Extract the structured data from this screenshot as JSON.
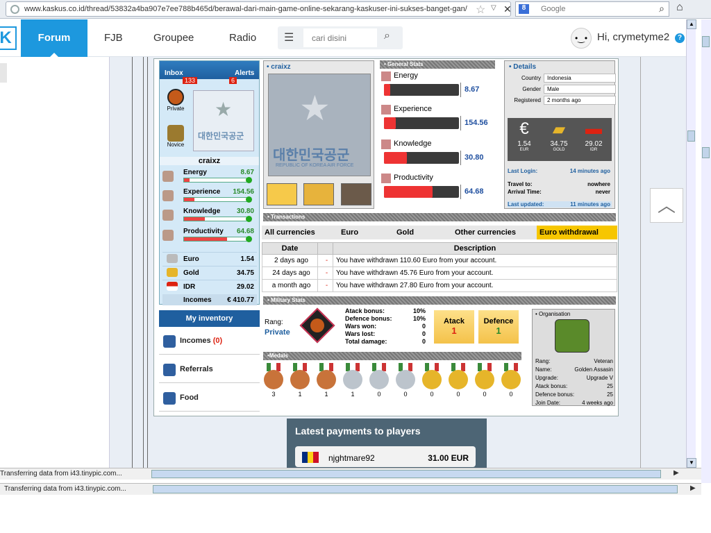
{
  "browser": {
    "url": "www.kaskus.co.id/thread/53832a4ba907e7ee788b465d/berawal-dari-main-game-online-sekarang-kaskuser-ini-sukses-banget-gan/",
    "search_placeholder": "Google",
    "search_badge": "8"
  },
  "nav": {
    "logo": "K",
    "items": [
      "Forum",
      "FJB",
      "Groupee",
      "Radio"
    ],
    "search_placeholder": "cari disini",
    "greeting": "Hi, crymetyme2",
    "help": "?"
  },
  "profile": {
    "inbox_label": "Inbox",
    "inbox_count": "133",
    "alerts_label": "Alerts",
    "alerts_count": "6",
    "rank1": "Private",
    "rank2": "Novice",
    "name": "craixz",
    "stats": [
      {
        "label": "Energy",
        "value": "8.67",
        "fill": 0.087
      },
      {
        "label": "Experience",
        "value": "154.56",
        "fill": 0.16
      },
      {
        "label": "Knowledge",
        "value": "30.80",
        "fill": 0.31
      },
      {
        "label": "Productivity",
        "value": "64.68",
        "fill": 0.65
      }
    ],
    "currencies": [
      {
        "label": "Euro",
        "value": "1.54"
      },
      {
        "label": "Gold",
        "value": "34.75"
      },
      {
        "label": "IDR",
        "value": "29.02"
      }
    ],
    "incomes_label": "Incomes",
    "incomes_value": "€ 410.77"
  },
  "inventory": {
    "title": "My inventory",
    "items": [
      {
        "label": "Incomes",
        "count": "(0)"
      },
      {
        "label": "Referrals"
      },
      {
        "label": "Food"
      }
    ]
  },
  "player": {
    "name": "• craixz",
    "emblem_text": "대한민국공군",
    "emblem_sub": "REPUBLIC OF KOREA AIR FORCE"
  },
  "general_stats": {
    "title": "• General Stats",
    "rows": [
      {
        "label": "Energy",
        "value": "8.67",
        "fill": 0.087
      },
      {
        "label": "Experience",
        "value": "154.56",
        "fill": 0.16
      },
      {
        "label": "Knowledge",
        "value": "30.80",
        "fill": 0.31
      },
      {
        "label": "Productivity",
        "value": "64.68",
        "fill": 0.65
      }
    ]
  },
  "details": {
    "title": "• Details",
    "country_label": "Country",
    "country": "Indonesia",
    "gender_label": "Gender",
    "gender": "Male",
    "registered_label": "Registered",
    "registered": "2 months ago",
    "cur": [
      {
        "value": "1.54",
        "code": "EUR"
      },
      {
        "value": "34.75",
        "code": "GOLD"
      },
      {
        "value": "29.02",
        "code": "IDR"
      }
    ],
    "last_login_label": "Last Login:",
    "last_login": "14 minutes ago",
    "travel_label": "Travel to:",
    "travel": "nowhere",
    "arrival_label": "Arrival Time:",
    "arrival": "never",
    "updated_label": "Last updated:",
    "updated": "11 minutes ago"
  },
  "transactions": {
    "title": "• Transactions",
    "tabs": [
      "All currencies",
      "Euro",
      "Gold",
      "Other currencies",
      "Euro withdrawal"
    ],
    "headers": [
      "Date",
      "Description"
    ],
    "rows": [
      {
        "date": "2 days ago",
        "sign": "-",
        "desc": "You have withdrawn 110.60 Euro from your account."
      },
      {
        "date": "24 days ago",
        "sign": "-",
        "desc": "You have withdrawn 45.76 Euro from your account."
      },
      {
        "date": "a month ago",
        "sign": "-",
        "desc": "You have withdrawn 27.80 Euro from your account."
      }
    ]
  },
  "military": {
    "title": "• Military Stats",
    "rang_label": "Rang:",
    "rang": "Private",
    "bonuses": [
      {
        "label": "Atack bonus:",
        "value": "10%"
      },
      {
        "label": "Defence bonus:",
        "value": "10%"
      },
      {
        "label": "Wars won:",
        "value": "0"
      },
      {
        "label": "Wars lost:",
        "value": "0"
      },
      {
        "label": "Total damage:",
        "value": "0"
      }
    ],
    "attack_label": "Atack",
    "attack_value": "1",
    "defence_label": "Defence",
    "defence_value": "1"
  },
  "organisation": {
    "title": "• Organisation",
    "rows": [
      {
        "label": "Rang:",
        "value": "Veteran"
      },
      {
        "label": "Name:",
        "value": "Golden Assasin"
      },
      {
        "label": "Upgrade:",
        "value": "Upgrade V"
      },
      {
        "label": "Atack bonus:",
        "value": "25"
      },
      {
        "label": "Defence bonus:",
        "value": "25"
      },
      {
        "label": "Join Date:",
        "value": "4 weeks ago"
      }
    ]
  },
  "medals": {
    "title": "•Medals",
    "items": [
      {
        "type": "bronze",
        "count": "3"
      },
      {
        "type": "bronze",
        "count": "1"
      },
      {
        "type": "bronze",
        "count": "1"
      },
      {
        "type": "silver",
        "count": "1"
      },
      {
        "type": "silver",
        "count": "0"
      },
      {
        "type": "silver",
        "count": "0"
      },
      {
        "type": "gold",
        "count": "0"
      },
      {
        "type": "gold",
        "count": "0"
      },
      {
        "type": "gold",
        "count": "0"
      },
      {
        "type": "gold",
        "count": "0"
      }
    ]
  },
  "payments": {
    "title": "Latest payments to players",
    "name": "njghtmare92",
    "amount": "31.00 EUR"
  },
  "status": {
    "line1": "Transferring data from i43.tinypic.com...",
    "line2": "Transferring data from i43.tinypic.com..."
  }
}
